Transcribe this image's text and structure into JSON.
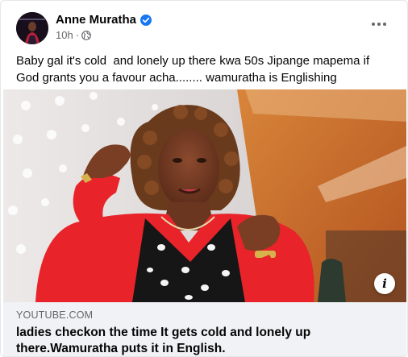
{
  "post": {
    "author": "Anne Muratha",
    "time": "10h",
    "separator": "·",
    "caption": "Baby gal it's cold  and lonely up there kwa 50s Jipange mapema if God grants you a favour acha........ wamuratha is Englishing",
    "link": {
      "domain": "YOUTUBE.COM",
      "title": "ladies checkon the time It gets cold and lonely up there.Wamuratha puts it in English."
    },
    "info_glyph": "i"
  },
  "icons": {
    "verified": "verified-badge-icon",
    "audience": "globe-icon",
    "more": "more-options-icon",
    "info": "info-icon"
  },
  "colors": {
    "verified_blue": "#1877f2",
    "secondary_text": "#65676b",
    "link_box_bg": "#f0f2f5",
    "jacket_red": "#e8242a"
  }
}
